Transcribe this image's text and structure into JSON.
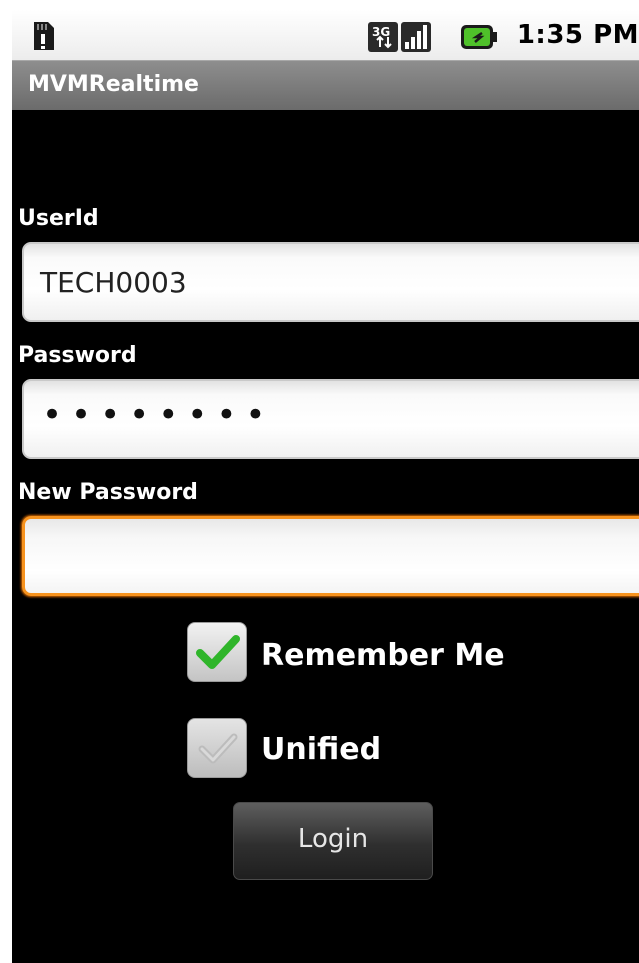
{
  "status_bar": {
    "network_label": "3G",
    "time": "1:35 PM",
    "icons": [
      "sd-card-icon",
      "network-3g-icon",
      "signal-icon",
      "battery-icon"
    ]
  },
  "app": {
    "title": "MVMRealtime"
  },
  "form": {
    "userid": {
      "label": "UserId",
      "value": "TECH0003"
    },
    "password": {
      "label": "Password",
      "masked_value": "••••••••"
    },
    "new_password": {
      "label": "New Password",
      "value": "",
      "focused": true
    },
    "remember_me": {
      "label": "Remember Me",
      "checked": true
    },
    "unified": {
      "label": "Unified",
      "checked": true
    },
    "login_label": "Login"
  },
  "colors": {
    "focus_border": "#f7931e",
    "check_green": "#2fb52a",
    "background": "#000000"
  }
}
